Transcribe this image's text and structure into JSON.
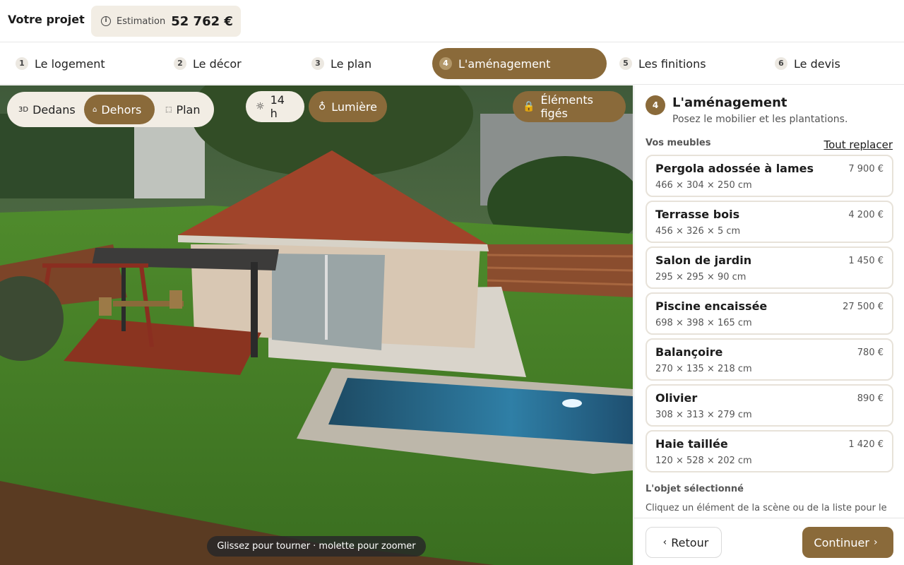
{
  "header": {
    "project_title": "Votre projet",
    "estimate_label": "Estimation",
    "estimate_value": "52 762 €"
  },
  "steps": [
    {
      "num": "1",
      "label": "Le logement"
    },
    {
      "num": "2",
      "label": "Le décor"
    },
    {
      "num": "3",
      "label": "Le plan"
    },
    {
      "num": "4",
      "label": "L'aménagement",
      "active": true
    },
    {
      "num": "5",
      "label": "Les finitions"
    },
    {
      "num": "6",
      "label": "Le devis"
    }
  ],
  "viewport": {
    "view_modes": [
      {
        "label": "Dedans",
        "icon": "3D"
      },
      {
        "label": "Dehors",
        "icon": "home-icon",
        "active": true
      },
      {
        "label": "Plan",
        "icon": "plan-icon"
      }
    ],
    "time_label": "14 h",
    "light_label": "Lumière",
    "frozen_label": "Éléments figés",
    "hint": "Glissez pour tourner · molette pour zoomer"
  },
  "panel": {
    "step_num": "4",
    "title": "L'aménagement",
    "subtitle": "Posez le mobilier et les plantations.",
    "furniture_label": "Vos meubles",
    "replace_all": "Tout replacer",
    "items": [
      {
        "name": "Pergola adossée à lames",
        "dims": "466 × 304 × 250 cm",
        "price": "7 900 €"
      },
      {
        "name": "Terrasse bois",
        "dims": "456 × 326 × 5 cm",
        "price": "4 200 €"
      },
      {
        "name": "Salon de jardin",
        "dims": "295 × 295 × 90 cm",
        "price": "1 450 €"
      },
      {
        "name": "Piscine encaissée",
        "dims": "698 × 398 × 165 cm",
        "price": "27 500 €"
      },
      {
        "name": "Balançoire",
        "dims": "270 × 135 × 218 cm",
        "price": "780 €"
      },
      {
        "name": "Olivier",
        "dims": "308 × 313 × 279 cm",
        "price": "890 €"
      },
      {
        "name": "Haie taillée",
        "dims": "120 × 528 × 202 cm",
        "price": "1 420 €"
      }
    ],
    "selected_label": "L'objet sélectionné",
    "selected_text": "Cliquez un élément de la scène ou de la liste pour le",
    "back": "Retour",
    "continue": "Continuer"
  },
  "colors": {
    "accent": "#8a6a3a",
    "chip_bg": "#f2ede4"
  }
}
